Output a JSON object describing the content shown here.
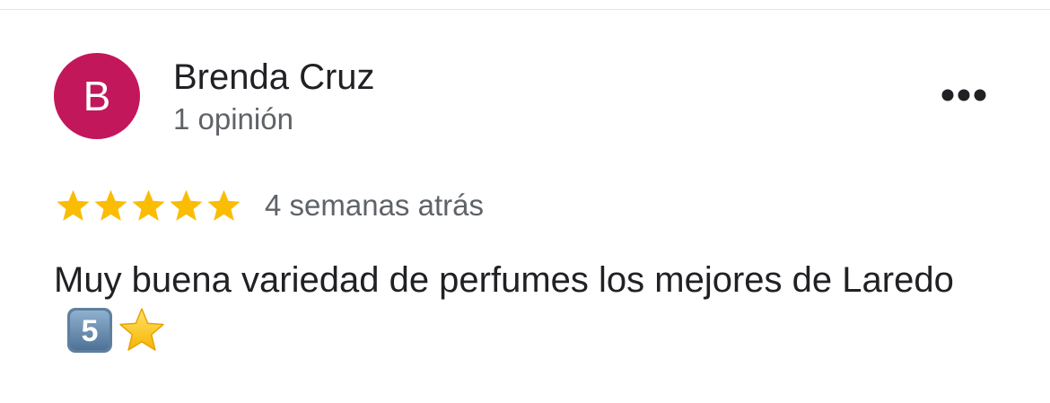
{
  "review": {
    "avatar_initial": "B",
    "avatar_color": "#c2185b",
    "reviewer_name": "Brenda Cruz",
    "review_count": "1 opinión",
    "more_icon": "more-horizontal-icon",
    "rating": 5,
    "rating_max": 5,
    "star_color": "#fbbc04",
    "date": "4 semanas atrás",
    "text": "Muy buena variedad de perfumes los mejores de Laredo",
    "emojis": [
      "keycap-5-emoji",
      "star-emoji"
    ]
  }
}
